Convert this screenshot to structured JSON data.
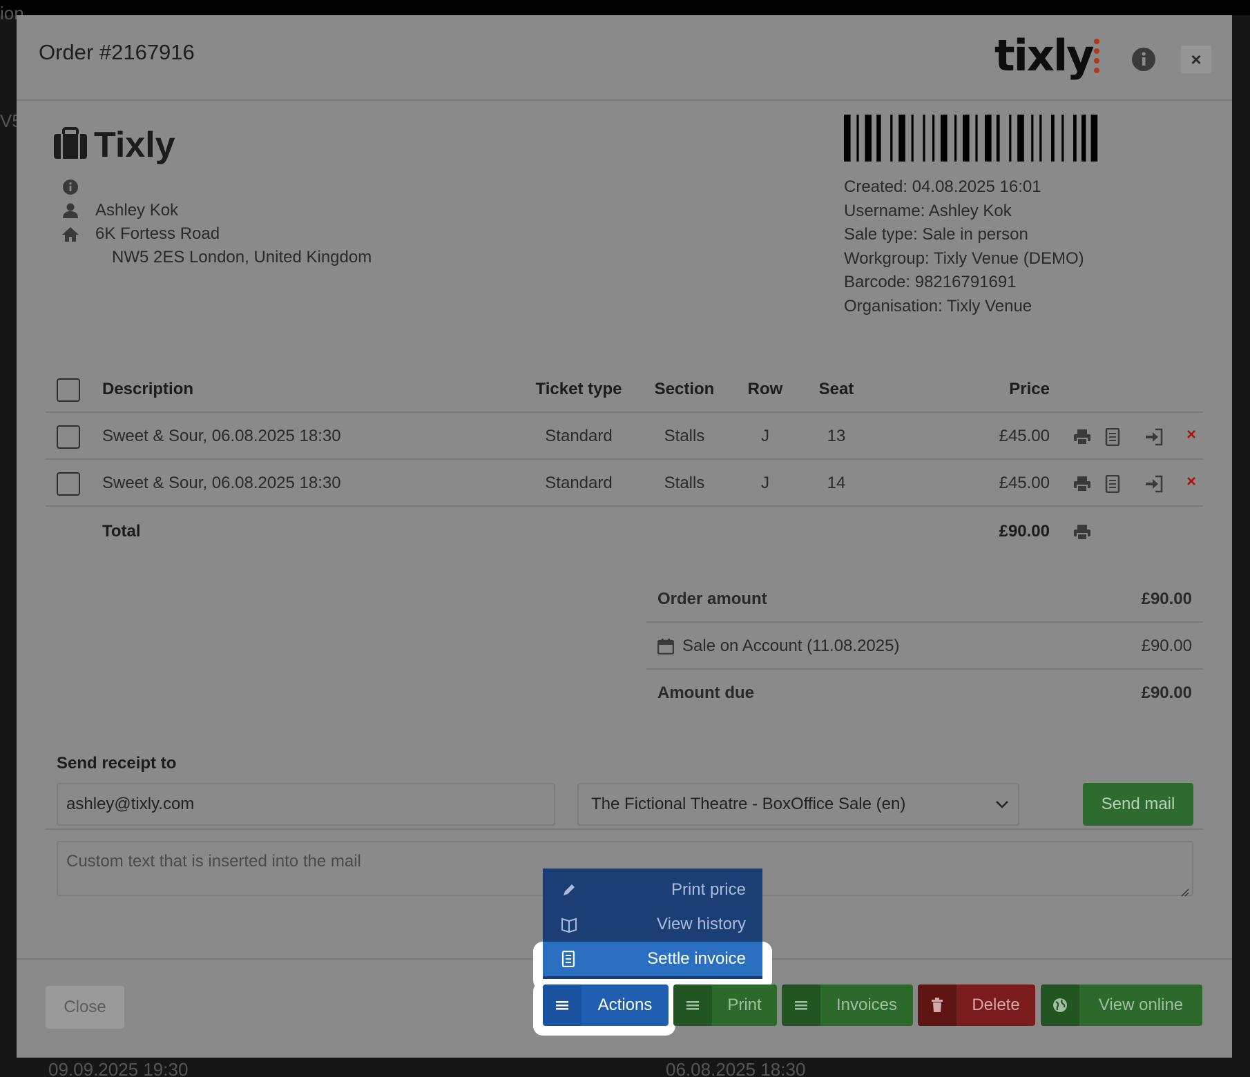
{
  "background": {
    "frag1": "ion",
    "frag2": "V5",
    "frag3": "09.09.2025 19:30",
    "frag4": "06.08.2025 18:30"
  },
  "header": {
    "title": "Order #2167916",
    "logo": "tixly"
  },
  "brand": {
    "name": "Tixly"
  },
  "customer": {
    "name": "Ashley Kok",
    "address_line1": "6K Fortess Road",
    "address_line2": "NW5 2ES London, United Kingdom"
  },
  "meta": {
    "created": "Created: 04.08.2025 16:01",
    "username": "Username: Ashley Kok",
    "sale_type": "Sale type: Sale in person",
    "workgroup": "Workgroup: Tixly Venue (DEMO)",
    "barcode": "Barcode: 98216791691",
    "organisation": "Organisation: Tixly Venue"
  },
  "table": {
    "headers": {
      "description": "Description",
      "ticket_type": "Ticket type",
      "section": "Section",
      "row": "Row",
      "seat": "Seat",
      "price": "Price"
    },
    "rows": [
      {
        "description": "Sweet & Sour, 06.08.2025 18:30",
        "ticket_type": "Standard",
        "section": "Stalls",
        "row": "J",
        "seat": "13",
        "price": "£45.00"
      },
      {
        "description": "Sweet & Sour, 06.08.2025 18:30",
        "ticket_type": "Standard",
        "section": "Stalls",
        "row": "J",
        "seat": "14",
        "price": "£45.00"
      }
    ],
    "total_label": "Total",
    "total_value": "£90.00"
  },
  "summary": {
    "order_amount_label": "Order amount",
    "order_amount": "£90.00",
    "payment_label": "Sale on Account (11.08.2025)",
    "payment_amount": "£90.00",
    "due_label": "Amount due",
    "due_amount": "£90.00"
  },
  "receipt": {
    "label": "Send receipt to",
    "email": "ashley@tixly.com",
    "template": "The Fictional Theatre - BoxOffice Sale (en)",
    "send_label": "Send mail",
    "custom_placeholder": "Custom text that is inserted into the mail"
  },
  "actions_menu": {
    "items": [
      "Print price",
      "View history",
      "Settle invoice"
    ]
  },
  "footer": {
    "close": "Close",
    "actions": "Actions",
    "print": "Print",
    "invoices": "Invoices",
    "delete": "Delete",
    "view_online": "View online"
  },
  "colors": {
    "overlay": "#8a8a8a",
    "primary": "#1f5eb0",
    "success": "#2c6a2c",
    "danger": "#7a1c1c",
    "brand_accent": "#b03a1a"
  }
}
